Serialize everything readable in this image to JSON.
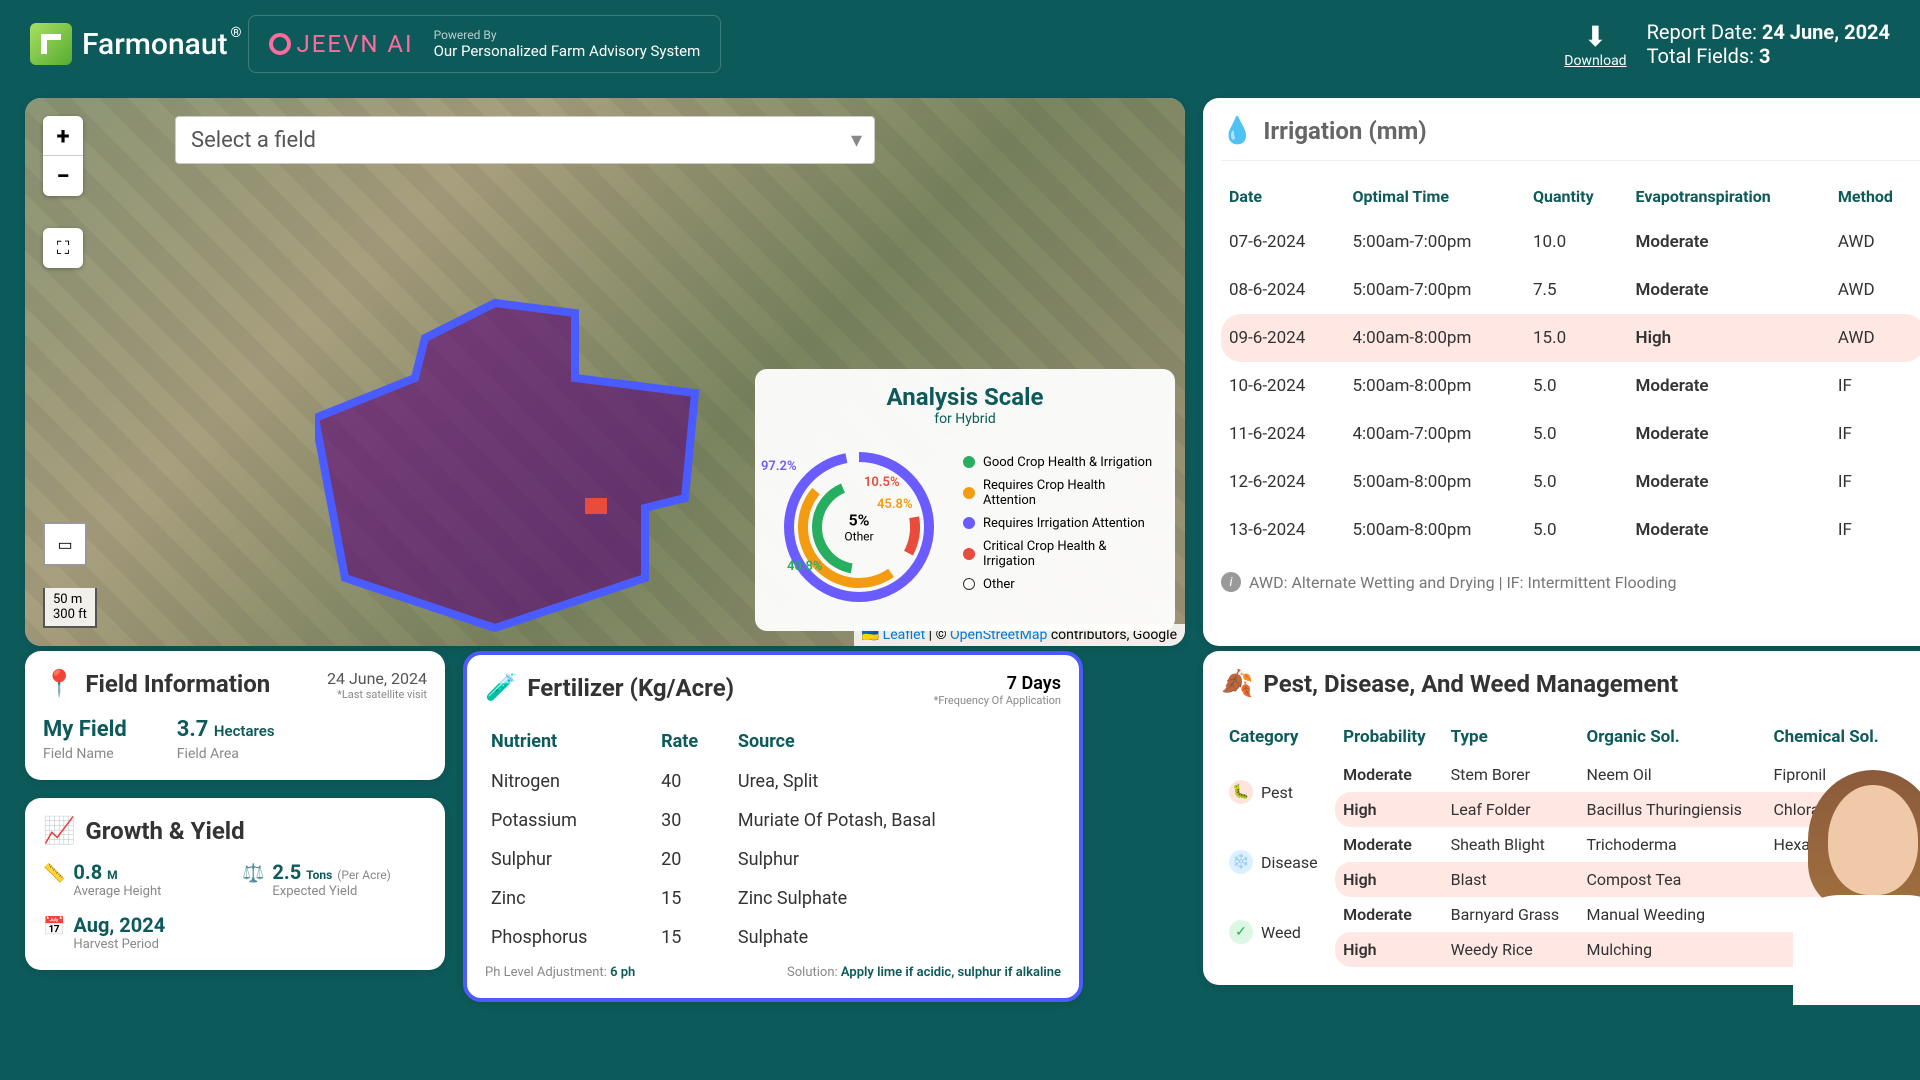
{
  "header": {
    "brand": "Farmonaut",
    "powered_label": "Powered By",
    "powered_sub": "Our Personalized Farm Advisory System",
    "jeevn": "JEEVN AI",
    "download": "Download",
    "report_date_label": "Report Date:",
    "report_date": "24 June, 2024",
    "total_fields_label": "Total Fields:",
    "total_fields": "3"
  },
  "map": {
    "select_placeholder": "Select a field",
    "scale_m": "50 m",
    "scale_ft": "300 ft",
    "leaflet": "Leaflet",
    "osm": "OpenStreetMap",
    "attr_suffix": "contributors, Google",
    "analysis_title": "Analysis Scale",
    "analysis_sub": "for Hybrid",
    "center_pct": "5%",
    "center_label": "Other",
    "labels": {
      "p1": "97.2%",
      "p2": "10.5%",
      "p3": "45.8%",
      "p4": "40.8%"
    },
    "legend": [
      {
        "color": "#27ae60",
        "text": "Good Crop Health & Irrigation"
      },
      {
        "color": "#f39c12",
        "text": "Requires Crop Health Attention"
      },
      {
        "color": "#6b5cff",
        "text": "Requires Irrigation Attention"
      },
      {
        "color": "#e74c3c",
        "text": "Critical Crop Health & Irrigation"
      },
      {
        "color": "#ffffff",
        "text": "Other"
      }
    ]
  },
  "field_info": {
    "title": "Field Information",
    "date": "24 June, 2024",
    "date_sub": "*Last satellite visit",
    "name_val": "My Field",
    "name_label": "Field Name",
    "area_val": "3.7",
    "area_unit": "Hectares",
    "area_label": "Field Area"
  },
  "growth": {
    "title": "Growth & Yield",
    "items": [
      {
        "val": "0.8",
        "unit": "M",
        "label": "Average Height"
      },
      {
        "val": "2.5",
        "unit": "Tons",
        "per": "(Per Acre)",
        "label": "Expected Yield"
      },
      {
        "val": "Aug, 2024",
        "unit": "",
        "label": "Harvest Period"
      }
    ]
  },
  "fert": {
    "title": "Fertilizer (Kg/Acre)",
    "days": "7 Days",
    "days_sub": "*Frequency Of Application",
    "cols": [
      "Nutrient",
      "Rate",
      "Source"
    ],
    "rows": [
      [
        "Nitrogen",
        "40",
        "Urea, Split"
      ],
      [
        "Potassium",
        "30",
        "Muriate Of Potash, Basal"
      ],
      [
        "Sulphur",
        "20",
        "Sulphur"
      ],
      [
        "Zinc",
        "15",
        "Zinc Sulphate"
      ],
      [
        "Phosphorus",
        "15",
        "Sulphate"
      ]
    ],
    "ph_label": "Ph Level Adjustment:",
    "ph_val": "6 ph",
    "sol_label": "Solution:",
    "sol_val": "Apply lime if acidic, sulphur if alkaline"
  },
  "irr": {
    "title": "Irrigation (mm)",
    "cols": [
      "Date",
      "Optimal Time",
      "Quantity",
      "Evapotranspiration",
      "Method"
    ],
    "rows": [
      {
        "d": "07-6-2024",
        "t": "5:00am-7:00pm",
        "q": "10.0",
        "e": "Moderate",
        "m": "AWD",
        "high": false
      },
      {
        "d": "08-6-2024",
        "t": "5:00am-7:00pm",
        "q": "7.5",
        "e": "Moderate",
        "m": "AWD",
        "high": false
      },
      {
        "d": "09-6-2024",
        "t": "4:00am-8:00pm",
        "q": "15.0",
        "e": "High",
        "m": "AWD",
        "high": true
      },
      {
        "d": "10-6-2024",
        "t": "5:00am-8:00pm",
        "q": "5.0",
        "e": "Moderate",
        "m": "IF",
        "high": false
      },
      {
        "d": "11-6-2024",
        "t": "4:00am-7:00pm",
        "q": "5.0",
        "e": "Moderate",
        "m": "IF",
        "high": false
      },
      {
        "d": "12-6-2024",
        "t": "5:00am-8:00pm",
        "q": "5.0",
        "e": "Moderate",
        "m": "IF",
        "high": false
      },
      {
        "d": "13-6-2024",
        "t": "5:00am-8:00pm",
        "q": "5.0",
        "e": "Moderate",
        "m": "IF",
        "high": false
      }
    ],
    "footer": "AWD: Alternate Wetting and Drying | IF: Intermittent Flooding"
  },
  "pest": {
    "title": "Pest, Disease, And Weed Management",
    "cols": [
      "Category",
      "Probability",
      "Type",
      "Organic Sol.",
      "Chemical Sol."
    ],
    "rows": [
      {
        "cat": "Pest",
        "icon": "pest",
        "span": true,
        "prob": "Moderate",
        "type": "Stem Borer",
        "org": "Neem Oil",
        "chem": "Fipronil"
      },
      {
        "cat": "",
        "icon": "",
        "span": false,
        "prob": "High",
        "type": "Leaf Folder",
        "org": "Bacillus Thuringiensis",
        "chem": "Chlorantraniliprole"
      },
      {
        "cat": "Disease",
        "icon": "disease",
        "span": true,
        "prob": "Moderate",
        "type": "Sheath Blight",
        "org": "Trichoderma",
        "chem": "Hexaconazole"
      },
      {
        "cat": "",
        "icon": "",
        "span": false,
        "prob": "High",
        "type": "Blast",
        "org": "Compost Tea",
        "chem": ""
      },
      {
        "cat": "Weed",
        "icon": "weed",
        "span": true,
        "prob": "Moderate",
        "type": "Barnyard Grass",
        "org": "Manual Weeding",
        "chem": ""
      },
      {
        "cat": "",
        "icon": "",
        "span": false,
        "prob": "High",
        "type": "Weedy Rice",
        "org": "Mulching",
        "chem": ""
      }
    ]
  }
}
